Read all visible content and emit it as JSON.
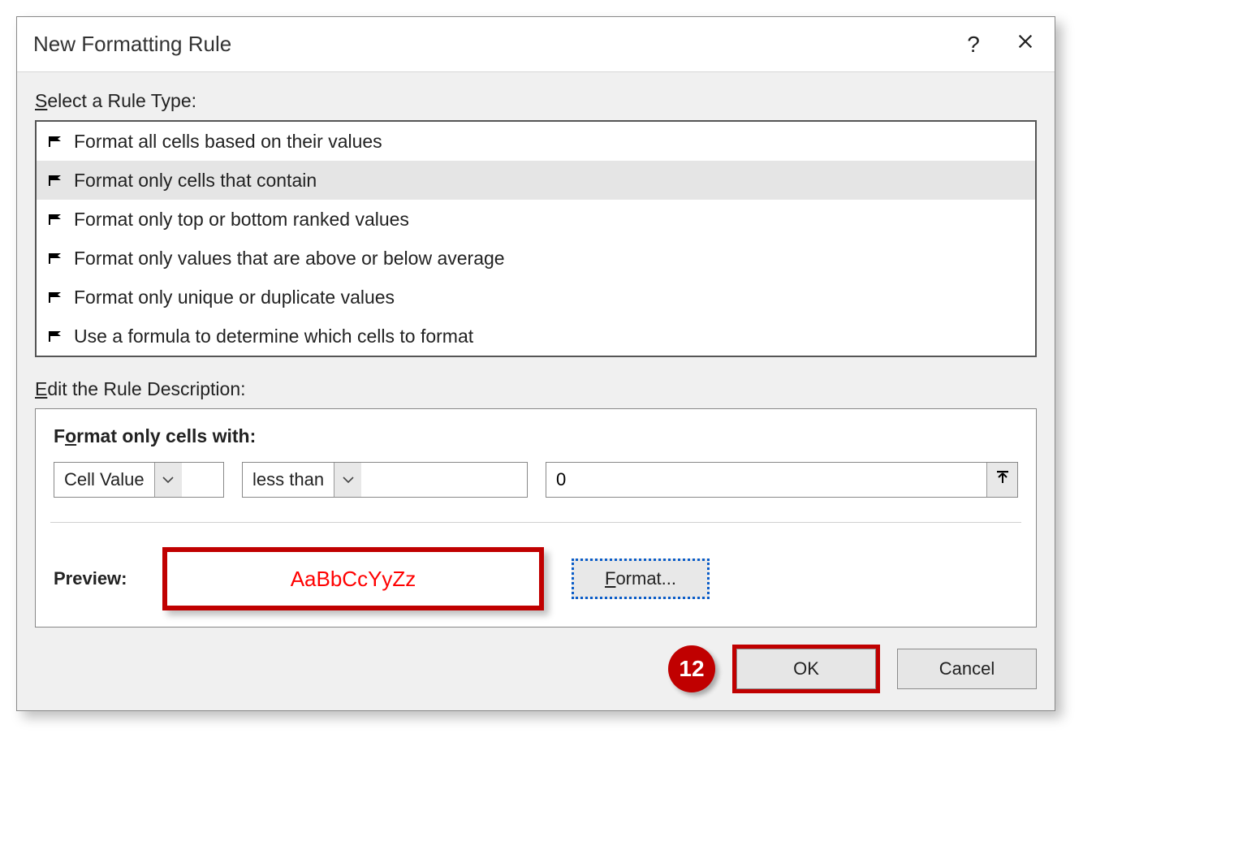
{
  "title": "New Formatting Rule",
  "select_label_pre": "S",
  "select_label_rest": "elect a Rule Type:",
  "rule_types": [
    "Format all cells based on their values",
    "Format only cells that contain",
    "Format only top or bottom ranked values",
    "Format only values that are above or below average",
    "Format only unique or duplicate values",
    "Use a formula to determine which cells to format"
  ],
  "selected_rule_index": 1,
  "edit_label_pre": "E",
  "edit_label_rest": "dit the Rule Description:",
  "criteria_header": "Format only cells with:",
  "criteria_header_u": "o",
  "combo1_value": "Cell Value",
  "combo2_value": "less than",
  "value_input": "0",
  "preview_label": "Preview:",
  "preview_text": "AaBbCcYyZz",
  "format_btn": "Format...",
  "format_btn_u": "F",
  "ok_label": "OK",
  "cancel_label": "Cancel",
  "step_number": "12"
}
